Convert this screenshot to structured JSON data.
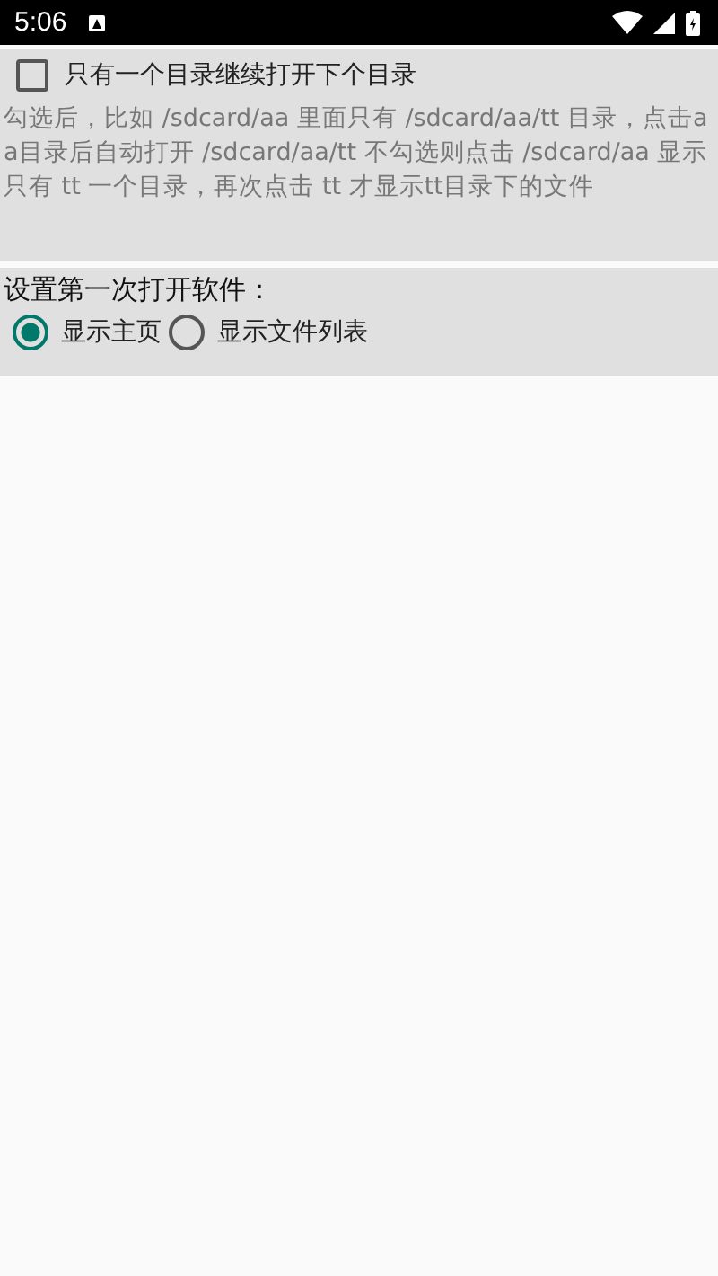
{
  "status_bar": {
    "time": "5:06"
  },
  "option": {
    "label": "只有一个目录继续打开下个目录",
    "checked": false,
    "description": "勾选后，比如 /sdcard/aa 里面只有 /sdcard/aa/tt 目录，点击aa目录后自动打开 /sdcard/aa/tt 不勾选则点击 /sdcard/aa 显示只有 tt 一个目录，再次点击 tt 才显示tt目录下的文件"
  },
  "startup": {
    "title": "设置第一次打开软件：",
    "choices": [
      {
        "label": "显示主页",
        "selected": true
      },
      {
        "label": "显示文件列表",
        "selected": false
      }
    ]
  }
}
